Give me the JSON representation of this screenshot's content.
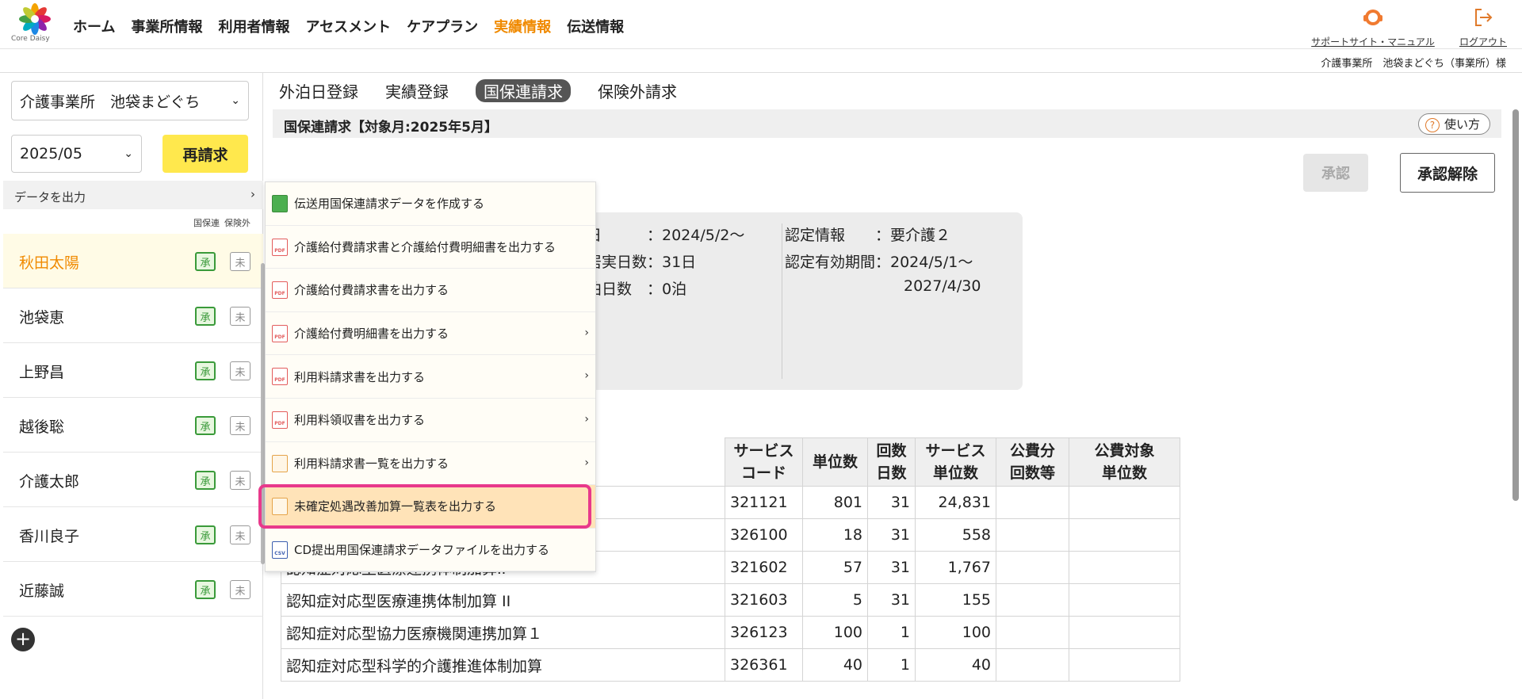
{
  "header": {
    "logo_text": "Core Daisy",
    "nav": [
      "ホーム",
      "事業所情報",
      "利用者情報",
      "アセスメント",
      "ケアプラン",
      "実績情報",
      "伝送情報"
    ],
    "nav_active_index": 5,
    "support_label": "サポートサイト・マニュアル",
    "logout_label": "ログアウト",
    "office_user": "介護事業所　池袋まどぐち（事業所）様"
  },
  "sidebar": {
    "office_select": "介護事業所　池袋まどぐち",
    "month_select": "2025/05",
    "rebill_label": "再請求",
    "data_out_label": "データを出力",
    "col_heads": [
      "国保連",
      "保険外"
    ],
    "users": [
      {
        "name": "秋田太陽",
        "ok": "承",
        "no": "未"
      },
      {
        "name": "池袋恵",
        "ok": "承",
        "no": "未"
      },
      {
        "name": "上野昌",
        "ok": "承",
        "no": "未"
      },
      {
        "name": "越後聡",
        "ok": "承",
        "no": "未"
      },
      {
        "name": "介護太郎",
        "ok": "承",
        "no": "未"
      },
      {
        "name": "香川良子",
        "ok": "承",
        "no": "未"
      },
      {
        "name": "近藤誠",
        "ok": "承",
        "no": "未"
      }
    ],
    "selected_index": 0
  },
  "main": {
    "tabs": [
      "外泊日登録",
      "実績登録",
      "国保連請求",
      "保険外請求"
    ],
    "active_tab": 2,
    "title": "国保連請求【対象月:2025年5月】",
    "usage_label": "使い方",
    "approve_label": "承認",
    "unapprove_label": "承認解除",
    "info": {
      "l1": "日　　　：2024/5/2〜",
      "l2": "居実日数：31日",
      "l3": "泊日数　：0泊",
      "r1": "認定情報　　：要介護２",
      "r2": "認定有効期間：2024/5/1〜",
      "r3": "2027/4/30"
    },
    "table": {
      "headers": [
        "サービス\nコード",
        "単位数",
        "回数\n日数",
        "サービス\n単位数",
        "公費分\n回数等",
        "公費対象\n単位数"
      ],
      "rows": [
        {
          "name": "",
          "code": "321121",
          "unit": "801",
          "days": "31",
          "svc": "24,831"
        },
        {
          "name": "",
          "code": "326100",
          "unit": "18",
          "days": "31",
          "svc": "558"
        },
        {
          "name": "認知症対応型医療連携体制加算ⅠⅠ",
          "code": "321602",
          "unit": "57",
          "days": "31",
          "svc": "1,767"
        },
        {
          "name": "認知症対応型医療連携体制加算 II",
          "code": "321603",
          "unit": "5",
          "days": "31",
          "svc": "155"
        },
        {
          "name": "認知症対応型協力医療機関連携加算１",
          "code": "326123",
          "unit": "100",
          "days": "1",
          "svc": "100"
        },
        {
          "name": "認知症対応型科学的介護推進体制加算",
          "code": "326361",
          "unit": "40",
          "days": "1",
          "svc": "40"
        }
      ]
    }
  },
  "menu": {
    "items": [
      {
        "label": "伝送用国保連請求データを作成する",
        "icon": "save",
        "sub": false
      },
      {
        "label": "介護給付費請求書と介護給付費明細書を出力する",
        "icon": "pdf",
        "sub": false
      },
      {
        "label": "介護給付費請求書を出力する",
        "icon": "pdf",
        "sub": false
      },
      {
        "label": "介護給付費明細書を出力する",
        "icon": "pdf",
        "sub": true
      },
      {
        "label": "利用料請求書を出力する",
        "icon": "pdf",
        "sub": true
      },
      {
        "label": "利用料領収書を出力する",
        "icon": "pdf",
        "sub": true
      },
      {
        "label": "利用料請求書一覧を出力する",
        "icon": "doc",
        "sub": true
      },
      {
        "label": "未確定処遇改善加算一覧表を出力する",
        "icon": "doc",
        "sub": false
      },
      {
        "label": "CD提出用国保連請求データファイルを出力する",
        "icon": "csv",
        "sub": false
      }
    ],
    "highlight_index": 7,
    "pdf_icon_text": "PDF",
    "csv_icon_text": "CSV"
  },
  "colors": {
    "accent": "#f08a00",
    "highlight": "#e8398b",
    "rebill": "#ffe84d"
  }
}
